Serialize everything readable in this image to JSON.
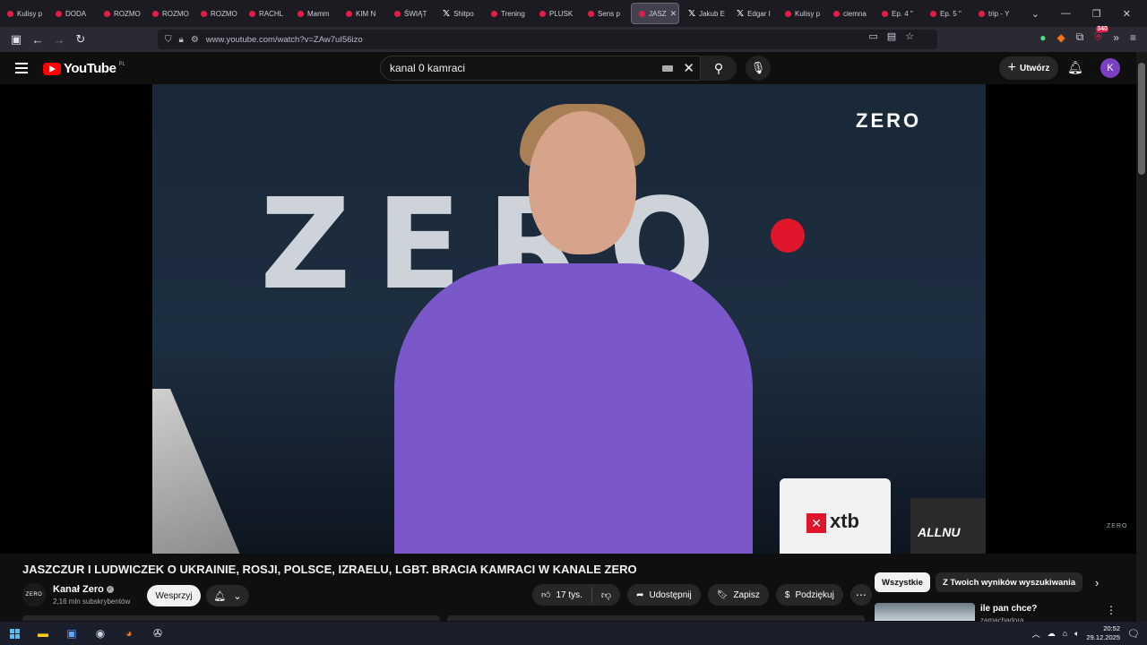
{
  "browser": {
    "tabs": [
      {
        "label": "Kulisy p",
        "icon": "youtube"
      },
      {
        "label": "DODA",
        "icon": "youtube"
      },
      {
        "label": "ROZMO",
        "icon": "youtube"
      },
      {
        "label": "ROZMO",
        "icon": "youtube"
      },
      {
        "label": "ROZMO",
        "icon": "youtube"
      },
      {
        "label": "RACHL",
        "icon": "youtube"
      },
      {
        "label": "Mamm",
        "icon": "youtube"
      },
      {
        "label": "KIM N",
        "icon": "youtube"
      },
      {
        "label": "ŚWIĄT",
        "icon": "youtube"
      },
      {
        "label": "Shitpo",
        "icon": "x"
      },
      {
        "label": "Trening",
        "icon": "youtube"
      },
      {
        "label": "PLUSK",
        "icon": "youtube"
      },
      {
        "label": "Sens p",
        "icon": "youtube"
      },
      {
        "label": "JASZ",
        "icon": "youtube",
        "active": true
      },
      {
        "label": "Jakub E",
        "icon": "x"
      },
      {
        "label": "Edgar I",
        "icon": "x"
      },
      {
        "label": "Kulisy p",
        "icon": "youtube"
      },
      {
        "label": "ciemna",
        "icon": "youtube"
      },
      {
        "label": "Ep. 4 \"",
        "icon": "youtube"
      },
      {
        "label": "Ep. 5 \"",
        "icon": "youtube"
      },
      {
        "label": "trip - Y",
        "icon": "youtube"
      }
    ],
    "url": "www.youtube.com/watch?v=ZAw7uI56izo",
    "extension_badge": "340"
  },
  "youtube": {
    "logo_text": "YouTube",
    "region": "PL",
    "search_value": "kanal 0 kamraci",
    "create_label": "Utwórz",
    "avatar_letter": "K"
  },
  "video": {
    "overlay_logo": "ZERO",
    "wall_text": "ZERO",
    "mug_brand": "xtb",
    "candy_text": "ALLNU",
    "watermark": "ZERO"
  },
  "details": {
    "title": "JASZCZUR I LUDWICZEK O UKRAINIE, ROSJI, POLSCE, IZRAELU, LGBT. BRACIA KAMRACI W KANALE ZERO",
    "channel_name": "Kanał Zero",
    "channel_logo_text": "ZERO",
    "subscribers": "2,16 mln subskrybentów",
    "support_label": "Wesprzyj",
    "likes": "17 tys.",
    "share_label": "Udostępnij",
    "save_label": "Zapisz",
    "thanks_label": "Podziękuj"
  },
  "sidebar": {
    "chips": [
      "Wszystkie",
      "Z Twoich wyników wyszukiwania"
    ],
    "reco_title": "ile pan chce?",
    "reco_channel": "zamachadora"
  },
  "taskbar": {
    "time": "20:52",
    "date": "29.12.2025"
  }
}
